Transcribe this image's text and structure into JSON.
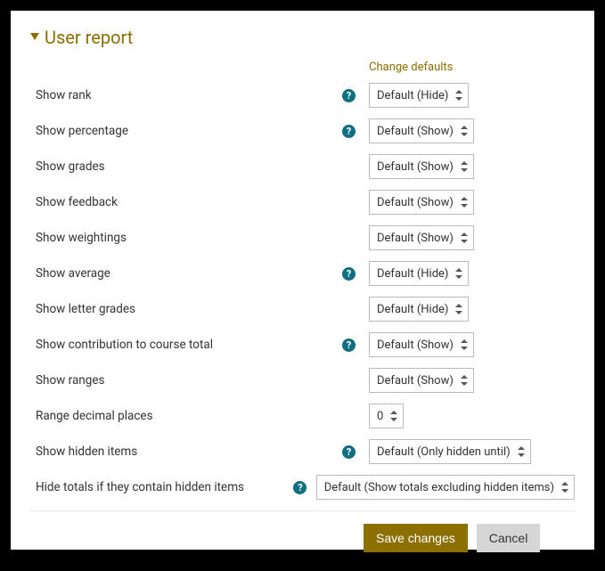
{
  "section": {
    "title": "User report",
    "change_defaults": "Change defaults"
  },
  "rows": {
    "show_rank": {
      "label": "Show rank",
      "help": true,
      "value": "Default (Hide)"
    },
    "show_percentage": {
      "label": "Show percentage",
      "help": true,
      "value": "Default (Show)"
    },
    "show_grades": {
      "label": "Show grades",
      "help": false,
      "value": "Default (Show)"
    },
    "show_feedback": {
      "label": "Show feedback",
      "help": false,
      "value": "Default (Show)"
    },
    "show_weightings": {
      "label": "Show weightings",
      "help": false,
      "value": "Default (Show)"
    },
    "show_average": {
      "label": "Show average",
      "help": true,
      "value": "Default (Hide)"
    },
    "show_letter": {
      "label": "Show letter grades",
      "help": false,
      "value": "Default (Hide)"
    },
    "show_contrib": {
      "label": "Show contribution to course total",
      "help": true,
      "value": "Default (Show)"
    },
    "show_ranges": {
      "label": "Show ranges",
      "help": false,
      "value": "Default (Show)"
    },
    "range_decimal": {
      "label": "Range decimal places",
      "help": false,
      "value": "0"
    },
    "show_hidden": {
      "label": "Show hidden items",
      "help": true,
      "value": "Default (Only hidden until)"
    },
    "hide_totals": {
      "label": "Hide totals if they contain hidden items",
      "help": true,
      "value": "Default (Show totals excluding hidden items)"
    }
  },
  "actions": {
    "save": "Save changes",
    "cancel": "Cancel"
  }
}
